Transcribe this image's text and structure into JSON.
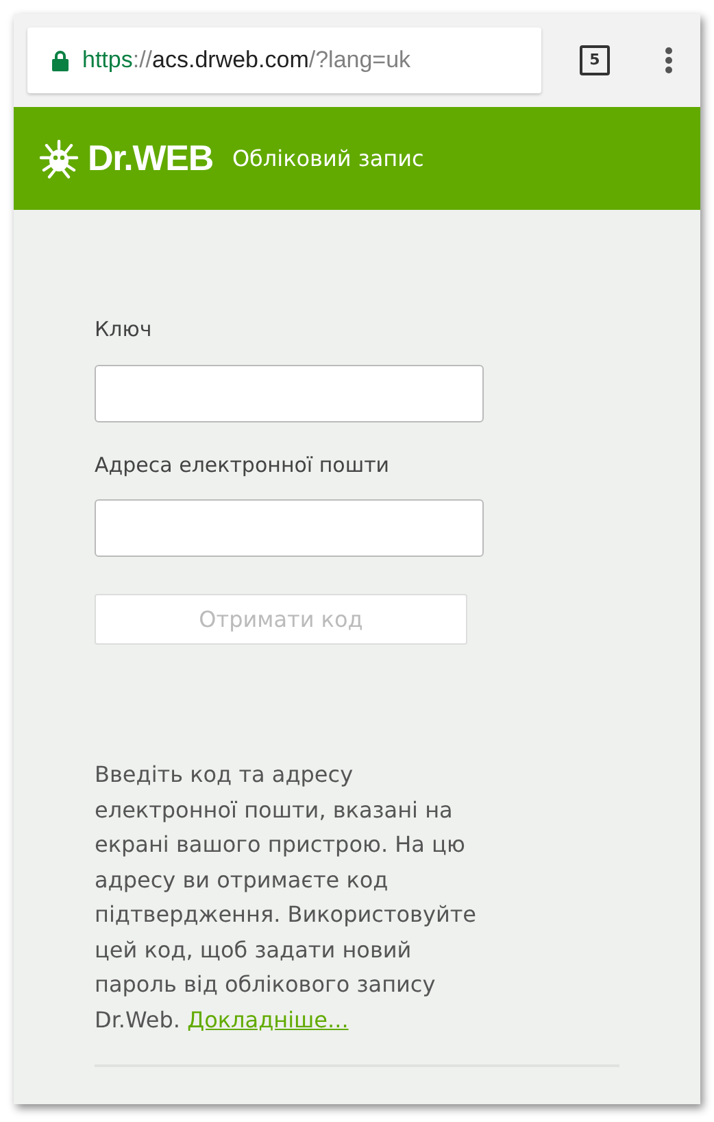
{
  "browser": {
    "url": {
      "scheme": "https",
      "separator": "://",
      "host": "acs.drweb.com",
      "path": "/?lang=uk"
    },
    "tab_count": "5"
  },
  "header": {
    "logo": "Dr.WEB",
    "title": "Обліковий запис"
  },
  "form": {
    "fields": [
      {
        "label": "Ключ"
      },
      {
        "label": "Адреса електронної пошти"
      }
    ],
    "button": {
      "label": "Отримати код",
      "disabled": true
    }
  },
  "info": {
    "text": "Введіть код та адресу електронної пошти, вказані на екрані вашого пристрою. На цю адресу ви отримаєте код підтвердження. Використовуйте цей код, щоб задати новий пароль від облікового запису Dr.Web.",
    "link": "Докладніше..."
  }
}
